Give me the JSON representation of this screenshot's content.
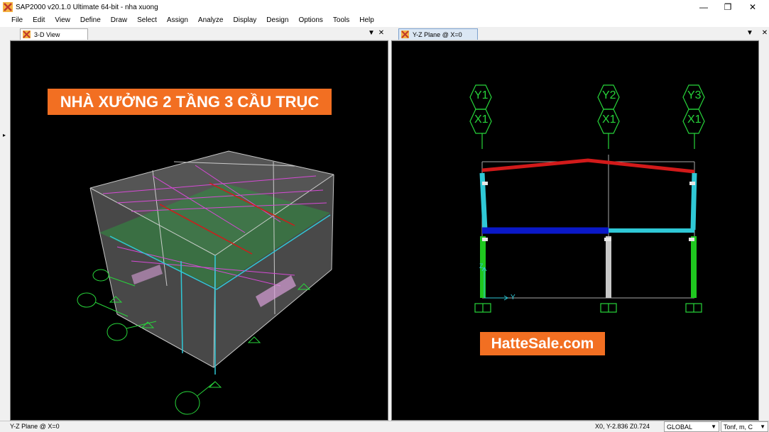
{
  "window": {
    "title": "SAP2000 v20.1.0 Ultimate 64-bit - nha xuong",
    "minimize": "—",
    "restore": "❐",
    "close": "✕",
    "icon": "sap2000-app-icon"
  },
  "menu": {
    "items": [
      "File",
      "Edit",
      "View",
      "Define",
      "Draw",
      "Select",
      "Assign",
      "Analyze",
      "Display",
      "Design",
      "Options",
      "Tools",
      "Help"
    ]
  },
  "left_pane": {
    "tab_label": "3-D View",
    "dropdown": "▼",
    "close": "✕",
    "banner": "NHÀ XƯỞNG 2 TẦNG 3 CẦU TRỤC"
  },
  "right_pane": {
    "tab_label": "Y-Z Plane @ X=0",
    "dropdown": "▼",
    "close": "✕",
    "banner": "HatteSale.com",
    "grid_labels_y": [
      "Y1",
      "Y2",
      "Y3"
    ],
    "grid_label_x": "X1",
    "axis_z": "Z",
    "axis_y": "Y"
  },
  "status": {
    "view_name": "Y-Z Plane @ X=0",
    "coords": "X0,  Y-2.836  Z0.724",
    "coord_system": "GLOBAL",
    "units": "Tonf, m, C"
  },
  "colors": {
    "banner_orange": "#f26f22",
    "beam_red": "#d21a1a",
    "beam_blue": "#0a18c8",
    "column_cyan": "#2fc8d6",
    "column_green": "#1fc81f",
    "grid_green": "#27d43a"
  }
}
